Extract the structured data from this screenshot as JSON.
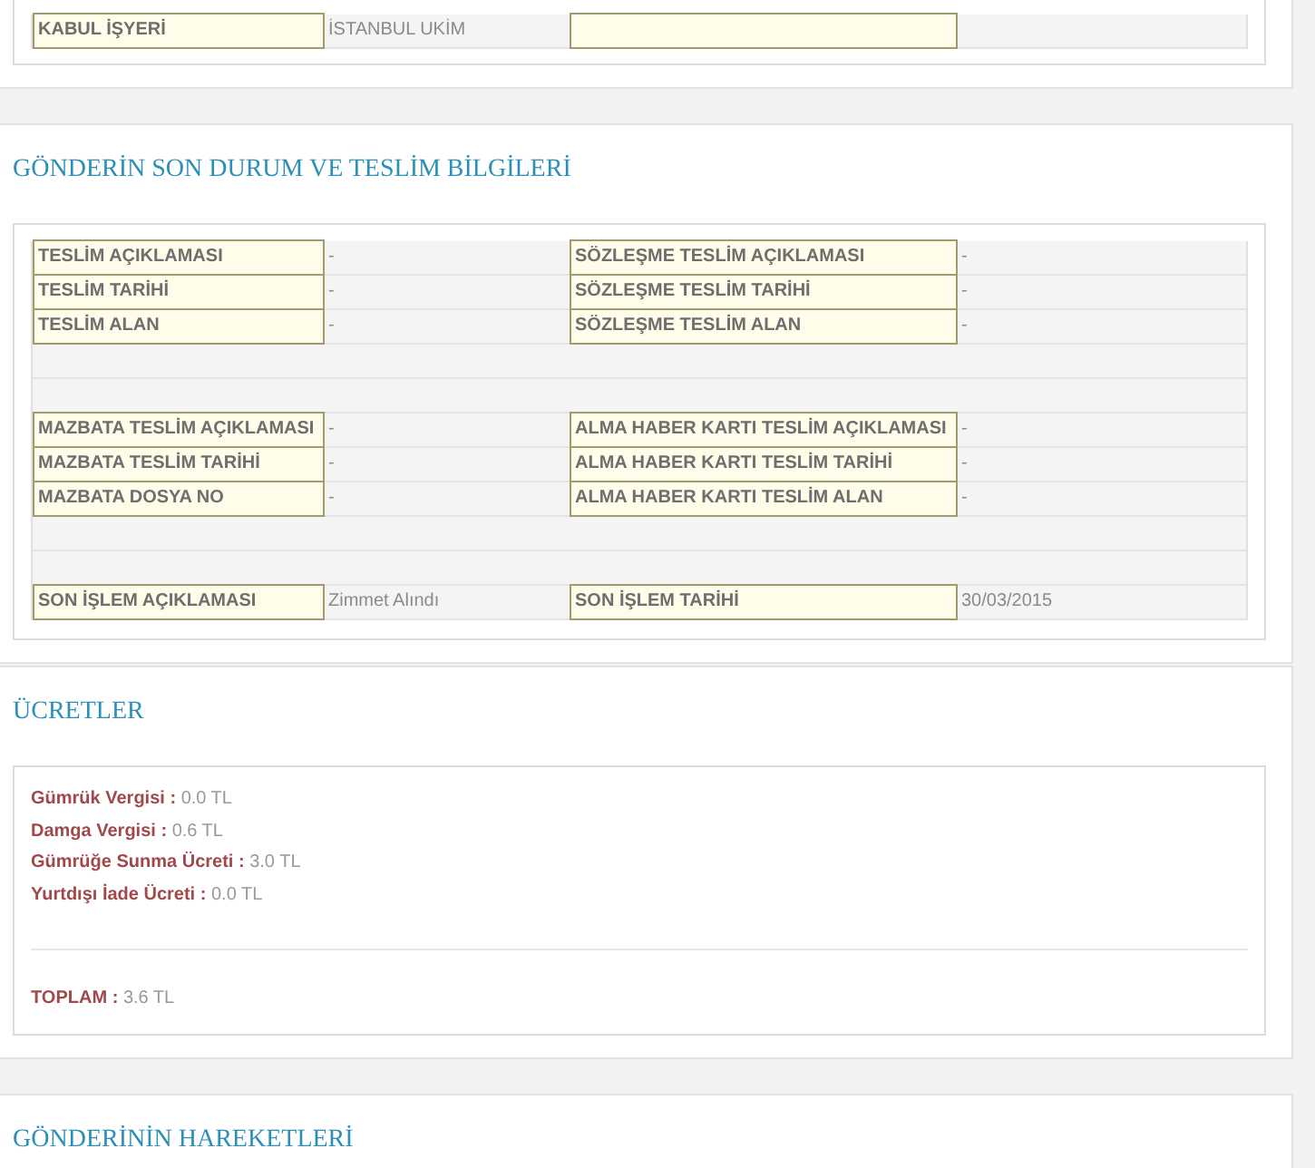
{
  "top_table": {
    "rows": [
      {
        "kind": "pair",
        "label_1": "KABUL İŞYERİ",
        "value_1": "İSTANBUL UKİM"
      }
    ]
  },
  "delivery": {
    "title": "GÖNDERİN SON DURUM VE TESLİM BİLGİLERİ",
    "rows": [
      {
        "kind": "pair",
        "label_1": "TESLİM AÇIKLAMASI",
        "value_1": "-",
        "label_2": "SÖZLEŞME TESLİM AÇIKLAMASI",
        "value_2": "-"
      },
      {
        "kind": "pair",
        "label_1": "TESLİM TARİHİ",
        "value_1": "-",
        "label_2": "SÖZLEŞME TESLİM TARİHİ",
        "value_2": "-"
      },
      {
        "kind": "pair",
        "label_1": "TESLİM ALAN",
        "value_1": "-",
        "label_2": "SÖZLEŞME TESLİM ALAN",
        "value_2": "-"
      },
      {
        "kind": "blank"
      },
      {
        "kind": "blank"
      },
      {
        "kind": "pair",
        "label_1": "MAZBATA TESLİM AÇIKLAMASI",
        "value_1": "-",
        "label_2": "ALMA HABER KARTI TESLİM AÇIKLAMASI",
        "value_2": "-"
      },
      {
        "kind": "pair",
        "label_1": "MAZBATA TESLİM TARİHİ",
        "value_1": "-",
        "label_2": "ALMA HABER KARTI TESLİM TARİHİ",
        "value_2": "-"
      },
      {
        "kind": "pair",
        "label_1": "MAZBATA DOSYA NO",
        "value_1": "-",
        "label_2": "ALMA HABER KARTI TESLİM ALAN",
        "value_2": "-"
      },
      {
        "kind": "blank"
      },
      {
        "kind": "blank"
      },
      {
        "kind": "pair",
        "label_1": "SON İŞLEM AÇIKLAMASI",
        "value_1": "Zimmet Alındı",
        "label_2": "SON İŞLEM TARİHİ",
        "value_2": "30/03/2015"
      }
    ]
  },
  "fees": {
    "title": "ÜCRETLER",
    "items": [
      {
        "label": "Gümrük Vergisi :",
        "value": "0.0 TL"
      },
      {
        "label": "Damga Vergisi :",
        "value": "0.6 TL"
      },
      {
        "label": "Gümrüğe Sunma Ücreti :",
        "value": "3.0 TL"
      },
      {
        "label": "Yurtdışı İade Ücreti :",
        "value": "0.0 TL"
      }
    ],
    "total": {
      "label": "TOPLAM :",
      "value": "3.6 TL"
    }
  },
  "movements": {
    "title": "GÖNDERİNİN HAREKETLERİ"
  }
}
